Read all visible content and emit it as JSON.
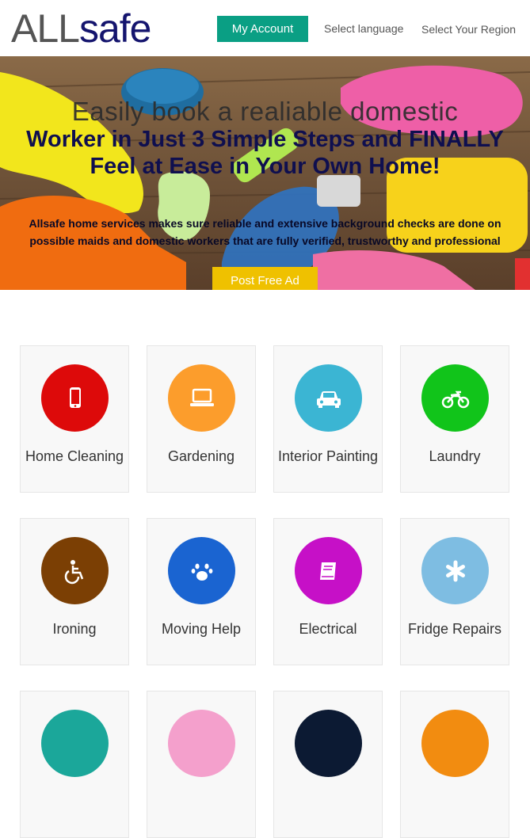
{
  "header": {
    "logo_part1": "ALL",
    "logo_part2": "safe",
    "my_account": "My Account",
    "select_language": "Select language",
    "select_region": "Select Your Region"
  },
  "hero": {
    "headline_light": "Easily book a realiable domestic",
    "headline_strong_1": "Worker in Just 3 Simple Steps and FINALLY",
    "headline_strong_2": "Feel at Ease in Your Own Home!",
    "subtext_1": "Allsafe home services makes sure reliable and extensive background checks are done on",
    "subtext_2": "possible maids and domestic workers that are fully verified, trustworthy and professional",
    "cta": "Post Free Ad"
  },
  "services": [
    {
      "label": "Home Cleaning",
      "icon": "mobile-phone-icon",
      "color": "#dd0a0a"
    },
    {
      "label": "Gardening",
      "icon": "laptop-icon",
      "color": "#fc9d2c"
    },
    {
      "label": "Interior Painting",
      "icon": "car-icon",
      "color": "#3bb5d3"
    },
    {
      "label": "Laundry",
      "icon": "motorcycle-icon",
      "color": "#11c41a"
    },
    {
      "label": "Ironing",
      "icon": "wheelchair-icon",
      "color": "#7b3f04"
    },
    {
      "label": "Moving Help",
      "icon": "paw-icon",
      "color": "#1a64d1"
    },
    {
      "label": "Electrical",
      "icon": "book-icon",
      "color": "#c610c7"
    },
    {
      "label": "Fridge Repairs",
      "icon": "asterisk-icon",
      "color": "#7ebde2"
    },
    {
      "label": "",
      "icon": "",
      "color": "#1ba79a"
    },
    {
      "label": "",
      "icon": "",
      "color": "#f4a0cc"
    },
    {
      "label": "",
      "icon": "",
      "color": "#0c1a33"
    },
    {
      "label": "",
      "icon": "",
      "color": "#f28c10"
    }
  ]
}
